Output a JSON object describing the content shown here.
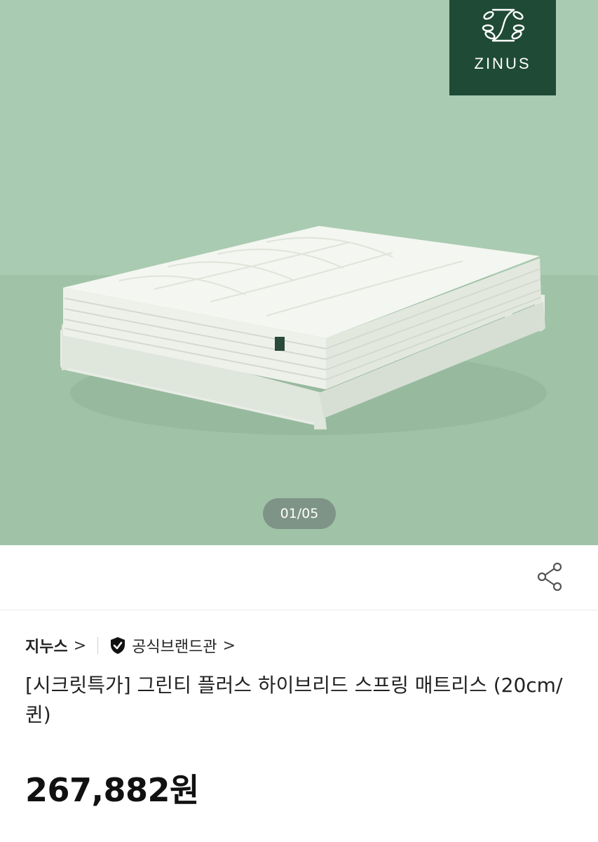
{
  "brand_logo": {
    "text": "ZINUS",
    "color": "#1f4a36"
  },
  "gallery": {
    "counter": "01/05"
  },
  "share": {
    "icon": "share-icon"
  },
  "meta": {
    "brand_name": "지누스",
    "brand_chevron": ">",
    "official_label": "공식브랜드관",
    "official_chevron": ">",
    "official_icon": "shield-check-icon"
  },
  "product": {
    "title": "[시크릿특가] 그린티 플러스 하이브리드 스프링 매트리스 (20cm/퀸)",
    "price": "267,882원"
  }
}
